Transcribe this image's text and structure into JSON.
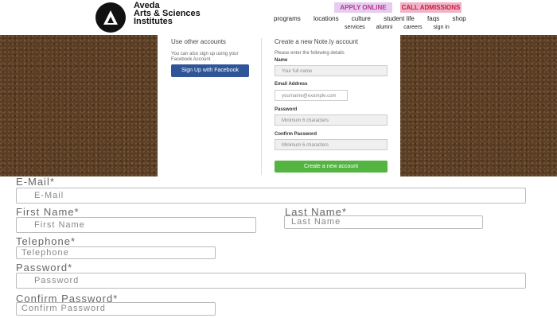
{
  "header": {
    "logo_icon": "triangle-a-logo",
    "logo_line1": "Aveda",
    "logo_line2": "Arts & Sciences",
    "logo_line3": "Institutes",
    "apply_label": "APPLY ONLINE",
    "call_label": "CALL ADMISSIONS",
    "nav_primary": [
      "programs",
      "locations",
      "culture",
      "student life",
      "faqs",
      "shop"
    ],
    "nav_secondary": [
      "services",
      "alumni",
      "careers",
      "sign in"
    ]
  },
  "panel": {
    "left_heading": "Use other accounts",
    "left_text_1": "You can also sign up using your",
    "left_text_2": "Facebook Account",
    "facebook_button": "Sign Up with Facebook",
    "right_heading": "Create a new Note.ly account",
    "right_intro": "Please enter the following details",
    "name_label": "Name",
    "name_placeholder": "Your full name",
    "email_label": "Email Address",
    "email_placeholder": "yourname@example.com",
    "password_label": "Password",
    "password_placeholder": "Minimum 6 characters",
    "confirm_label": "Confirm Password",
    "confirm_placeholder": "Minimum 6 characters",
    "submit_button": "Create a new account"
  },
  "form": {
    "email_label": "E-Mail*",
    "email_placeholder": "E-Mail",
    "first_name_label": "First Name*",
    "first_name_placeholder": "First Name",
    "last_name_label": "Last Name*",
    "last_name_placeholder": "Last Name",
    "telephone_label": "Telephone*",
    "telephone_placeholder": "Telephone",
    "password_label": "Password*",
    "password_placeholder": "Password",
    "confirm_label": "Confirm Password*",
    "confirm_placeholder": "Confirm Password"
  },
  "colors": {
    "facebook_blue": "#2f5598",
    "create_green": "#53b441",
    "apply_bg": "#e6ccf0",
    "call_bg": "#f1b1c6",
    "texture_brown": "#5b3d22"
  }
}
